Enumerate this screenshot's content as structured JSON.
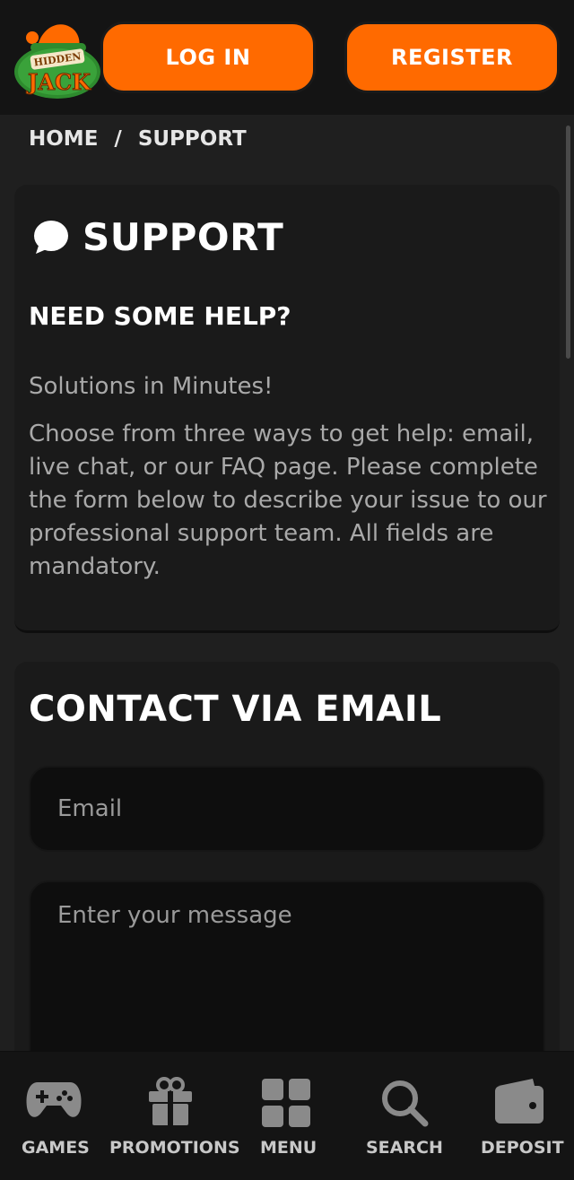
{
  "header": {
    "logo_text": "HIDDEN JACK",
    "login_label": "LOG IN",
    "register_label": "REGISTER"
  },
  "breadcrumb": {
    "home": "HOME",
    "separator": "/",
    "current": "SUPPORT"
  },
  "support": {
    "icon": "chat-bubble-icon",
    "title": "SUPPORT",
    "heading": "NEED SOME HELP?",
    "tagline": "Solutions in Minutes!",
    "description": "Choose from three ways to get help: email, live chat, or our FAQ page. Please complete the form below to describe your issue to our professional support team. All fields are mandatory."
  },
  "contact": {
    "title": "CONTACT VIA EMAIL",
    "email_placeholder": "Email",
    "message_placeholder": "Enter your message"
  },
  "bottom_nav": [
    {
      "label": "GAMES",
      "icon": "gamepad-icon"
    },
    {
      "label": "PROMOTIONS",
      "icon": "gift-icon"
    },
    {
      "label": "MENU",
      "icon": "grid-icon"
    },
    {
      "label": "SEARCH",
      "icon": "search-icon"
    },
    {
      "label": "DEPOSIT",
      "icon": "wallet-icon"
    }
  ],
  "colors": {
    "accent": "#ff6a00",
    "background": "#1f1f1f",
    "header": "#141414",
    "card": "#1a1a1a",
    "muted_text": "#a9a9a9"
  }
}
